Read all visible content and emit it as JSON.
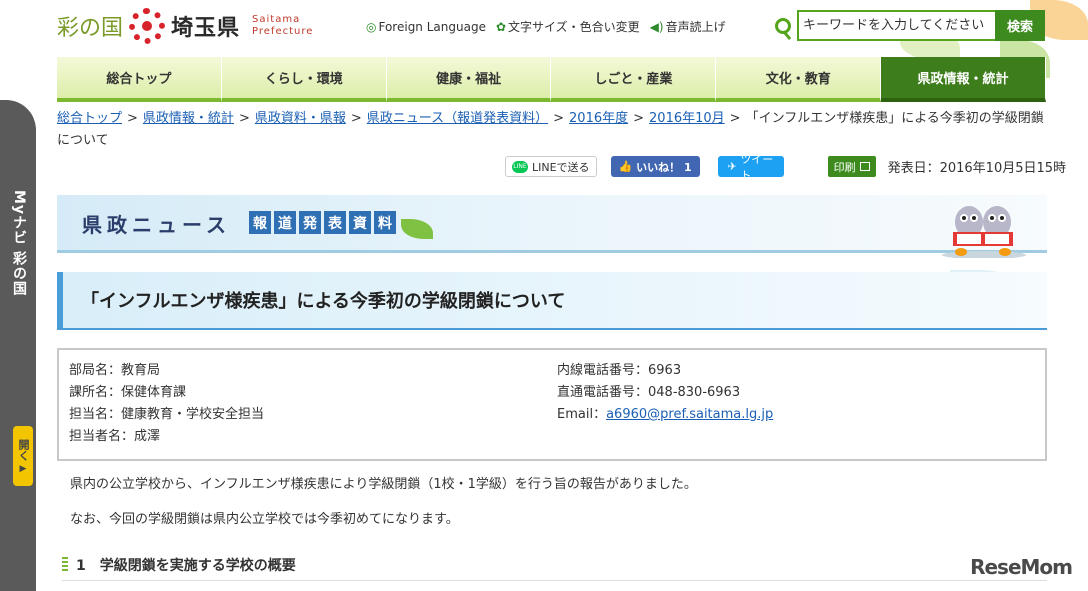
{
  "side_panel": {
    "label": "Myナビ 彩の国",
    "open_label": "開く"
  },
  "header": {
    "logo_kanji": "彩の国",
    "logo_pref": "埼玉県",
    "logo_en_1": "Saitama",
    "logo_en_2": "Prefecture",
    "util": {
      "foreign": "Foreign Language",
      "font_color": "文字サイズ・色合い変更",
      "speech": "音声読上げ"
    },
    "search": {
      "placeholder": "キーワードを入力してください",
      "button": "検索"
    }
  },
  "nav": {
    "items": [
      "総合トップ",
      "くらし・環境",
      "健康・福祉",
      "しごと・産業",
      "文化・教育",
      "県政情報・統計"
    ],
    "active_index": 5
  },
  "breadcrumb": {
    "items": [
      "総合トップ",
      "県政情報・統計",
      "県政資料・県報",
      "県政ニュース（報道発表資料）",
      "2016年度",
      "2016年10月"
    ],
    "separator": ">",
    "current": "「インフルエンザ様疾患」による今季初の学級閉鎖について"
  },
  "share": {
    "line": "LINEで送る",
    "line_badge": "LINE",
    "facebook": "いいね！ 1",
    "twitter": "ツイート",
    "print": "印刷",
    "published": "発表日：2016年10月5日15時"
  },
  "banner": {
    "title": "県政ニュース",
    "tags": [
      "報",
      "道",
      "発",
      "表",
      "資",
      "料"
    ]
  },
  "article": {
    "title": "「インフルエンザ様疾患」による今季初の学級閉鎖について",
    "contact_left": [
      "部局名：教育局",
      "課所名：保健体育課",
      "担当名：健康教育・学校安全担当",
      "担当者名：成澤"
    ],
    "contact_right": {
      "ext": "内線電話番号：6963",
      "direct": "直通電話番号：048-830-6963",
      "email_label": "Email：",
      "email": "a6960@pref.saitama.lg.jp"
    },
    "paragraph1": "県内の公立学校から、インフルエンザ様疾患により学級閉鎖（1校・1学級）を行う旨の報告がありました。",
    "paragraph2": "なお、今回の学級閉鎖は県内公立学校では今季初めてになります。",
    "section1": "1　学級閉鎖を実施する学校の概要"
  },
  "watermark": "ReseMom",
  "colors": {
    "green_primary": "#3d8b1e",
    "nav_bg": "#dceeaa",
    "link": "#1a5fb4",
    "banner_blue": "#2f6fb3"
  }
}
